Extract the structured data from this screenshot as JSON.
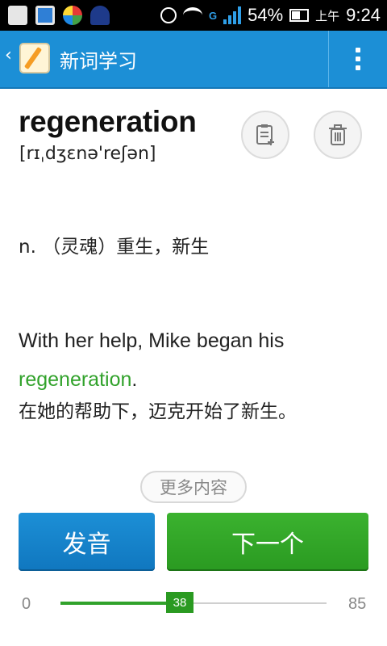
{
  "status_bar": {
    "network_label": "G",
    "battery_percent": "54%",
    "ampm": "上午",
    "time": "9:24"
  },
  "action_bar": {
    "back_icon": "chevron-left-icon",
    "logo_icon": "word-notebook-logo",
    "title": "新词学习",
    "overflow_icon": "overflow-menu-icon"
  },
  "word": {
    "text": "regeneration",
    "phonetic": "[rɪˌdʒɛnə'reʃən]",
    "definition": "n. （灵魂）重生，新生"
  },
  "actions": {
    "add_note_icon": "add-note-icon",
    "delete_icon": "trash-icon"
  },
  "example": {
    "before": "With her help, Mike began his ",
    "highlight": "regeneration",
    "after": ".",
    "translation": "在她的帮助下，迈克开始了新生。",
    "highlight_color": "#31a22b"
  },
  "more_label": "更多内容",
  "buttons": {
    "pronounce": "发音",
    "next": "下一个"
  },
  "progress": {
    "min": "0",
    "max": "85",
    "current": "38"
  },
  "colors": {
    "primary_blue": "#1c8fd6",
    "primary_green": "#31a22b"
  }
}
